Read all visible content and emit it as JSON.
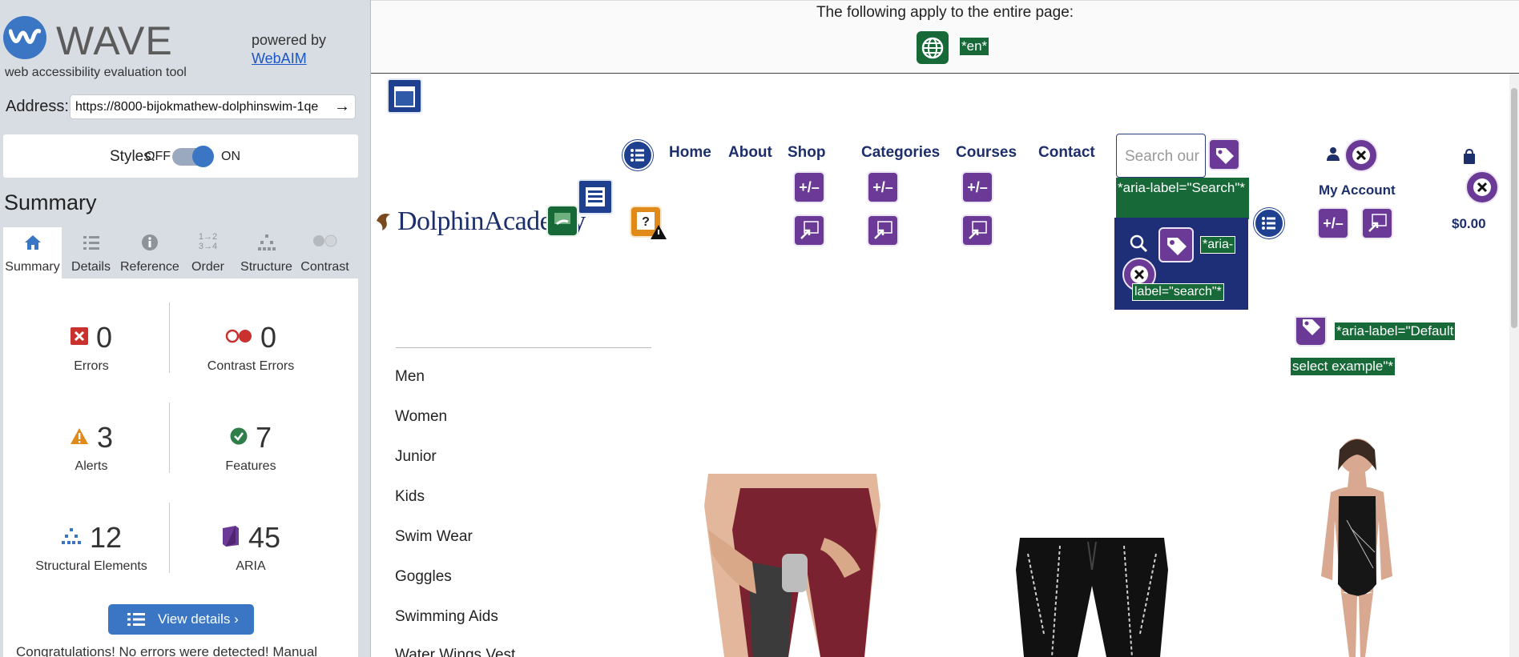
{
  "wave": {
    "title": "WAVE",
    "subtitle": "web accessibility evaluation tool",
    "powered_by": "powered by",
    "webaim_link": "WebAIM",
    "address_label": "Address:",
    "address_value": "https://8000-bijokmathew-dolphinswim-1qe",
    "styles_label": "Styles:",
    "styles_off": "OFF",
    "styles_on": "ON",
    "summary_heading": "Summary",
    "tabs": [
      {
        "label": "Summary",
        "icon": "home-icon"
      },
      {
        "label": "Details",
        "icon": "list-icon"
      },
      {
        "label": "Reference",
        "icon": "info-icon"
      },
      {
        "label": "Order",
        "icon": "order-icon"
      },
      {
        "label": "Structure",
        "icon": "structure-icon"
      },
      {
        "label": "Contrast",
        "icon": "contrast-icon"
      }
    ],
    "stats": {
      "errors": {
        "value": "0",
        "label": "Errors"
      },
      "contrast_errors": {
        "value": "0",
        "label": "Contrast Errors"
      },
      "alerts": {
        "value": "3",
        "label": "Alerts"
      },
      "features": {
        "value": "7",
        "label": "Features"
      },
      "structural": {
        "value": "12",
        "label": "Structural Elements"
      },
      "aria": {
        "value": "45",
        "label": "ARIA"
      }
    },
    "view_details": "View details ›",
    "congrats": "Congratulations! No errors were detected! Manual"
  },
  "page": {
    "banner_text": "The following apply to the entire page:",
    "lang_chip": "*en*",
    "logo_text": "DolphinAcademy",
    "nav": [
      "Home",
      "About",
      "Shop",
      "Categories",
      "Courses",
      "Contact"
    ],
    "search_placeholder": "Search our",
    "aria_search_label": "*aria-label=\"Search\"*",
    "aria_search_label_a": "*aria-",
    "aria_search_label_b": "label=\"search\"*",
    "my_account": "My Account",
    "cart_total": "$0.00",
    "aria_default_a": "*aria-label=\"Default",
    "aria_default_b": "select example\"*",
    "categories": [
      "Men",
      "Women",
      "Junior",
      "Kids",
      "Swim Wear",
      "Goggles",
      "Swimming Aids",
      "Water Wings Vest"
    ]
  },
  "colors": {
    "wave_blue": "#3a76c4",
    "aria_purple": "#6b3a96",
    "feature_green": "#176938",
    "nav_navy": "#1c2f6b",
    "error_red": "#c8312e",
    "alert_orange": "#e08a1a"
  }
}
